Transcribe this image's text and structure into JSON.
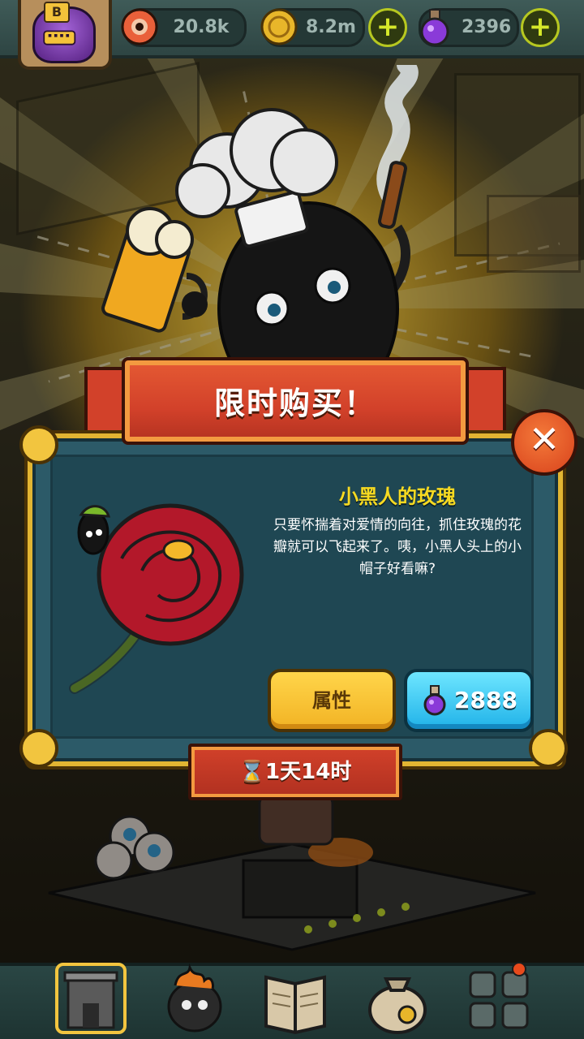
{
  "top_bar": {
    "profile_badge": "B",
    "resources": [
      {
        "icon": "eyeball-icon",
        "value": "20.8k"
      },
      {
        "icon": "gold-coin-icon",
        "value": "8.2m"
      },
      {
        "icon": "purple-potion-icon",
        "value": "2396"
      }
    ],
    "plus_label": "+"
  },
  "offer": {
    "banner_title": "限时购买！",
    "item_name": "小黑人的玫瑰",
    "item_description": "只要怀揣着对爱情的向往，抓住玫瑰的花瓣就可以飞起来了。咦，小黑人头上的小帽子好看嘛?",
    "attributes_button": "属性",
    "price": "2888",
    "price_icon": "purple-potion-icon",
    "timer": "1天14时",
    "timer_icon": "hourglass-icon",
    "close_icon": "close-icon"
  },
  "bottom_nav": {
    "items": [
      {
        "icon": "building-icon"
      },
      {
        "icon": "furnace-character-icon"
      },
      {
        "icon": "book-icon"
      },
      {
        "icon": "money-bag-icon"
      },
      {
        "icon": "grid-menu-icon"
      }
    ]
  },
  "colors": {
    "banner_red": "#d2412a",
    "panel_teal": "#2c5a68",
    "frame_gold": "#e2b532",
    "item_name_yellow": "#f7da21",
    "buy_button_cyan": "#20b2e8",
    "attr_button_yellow": "#ffd54a"
  }
}
